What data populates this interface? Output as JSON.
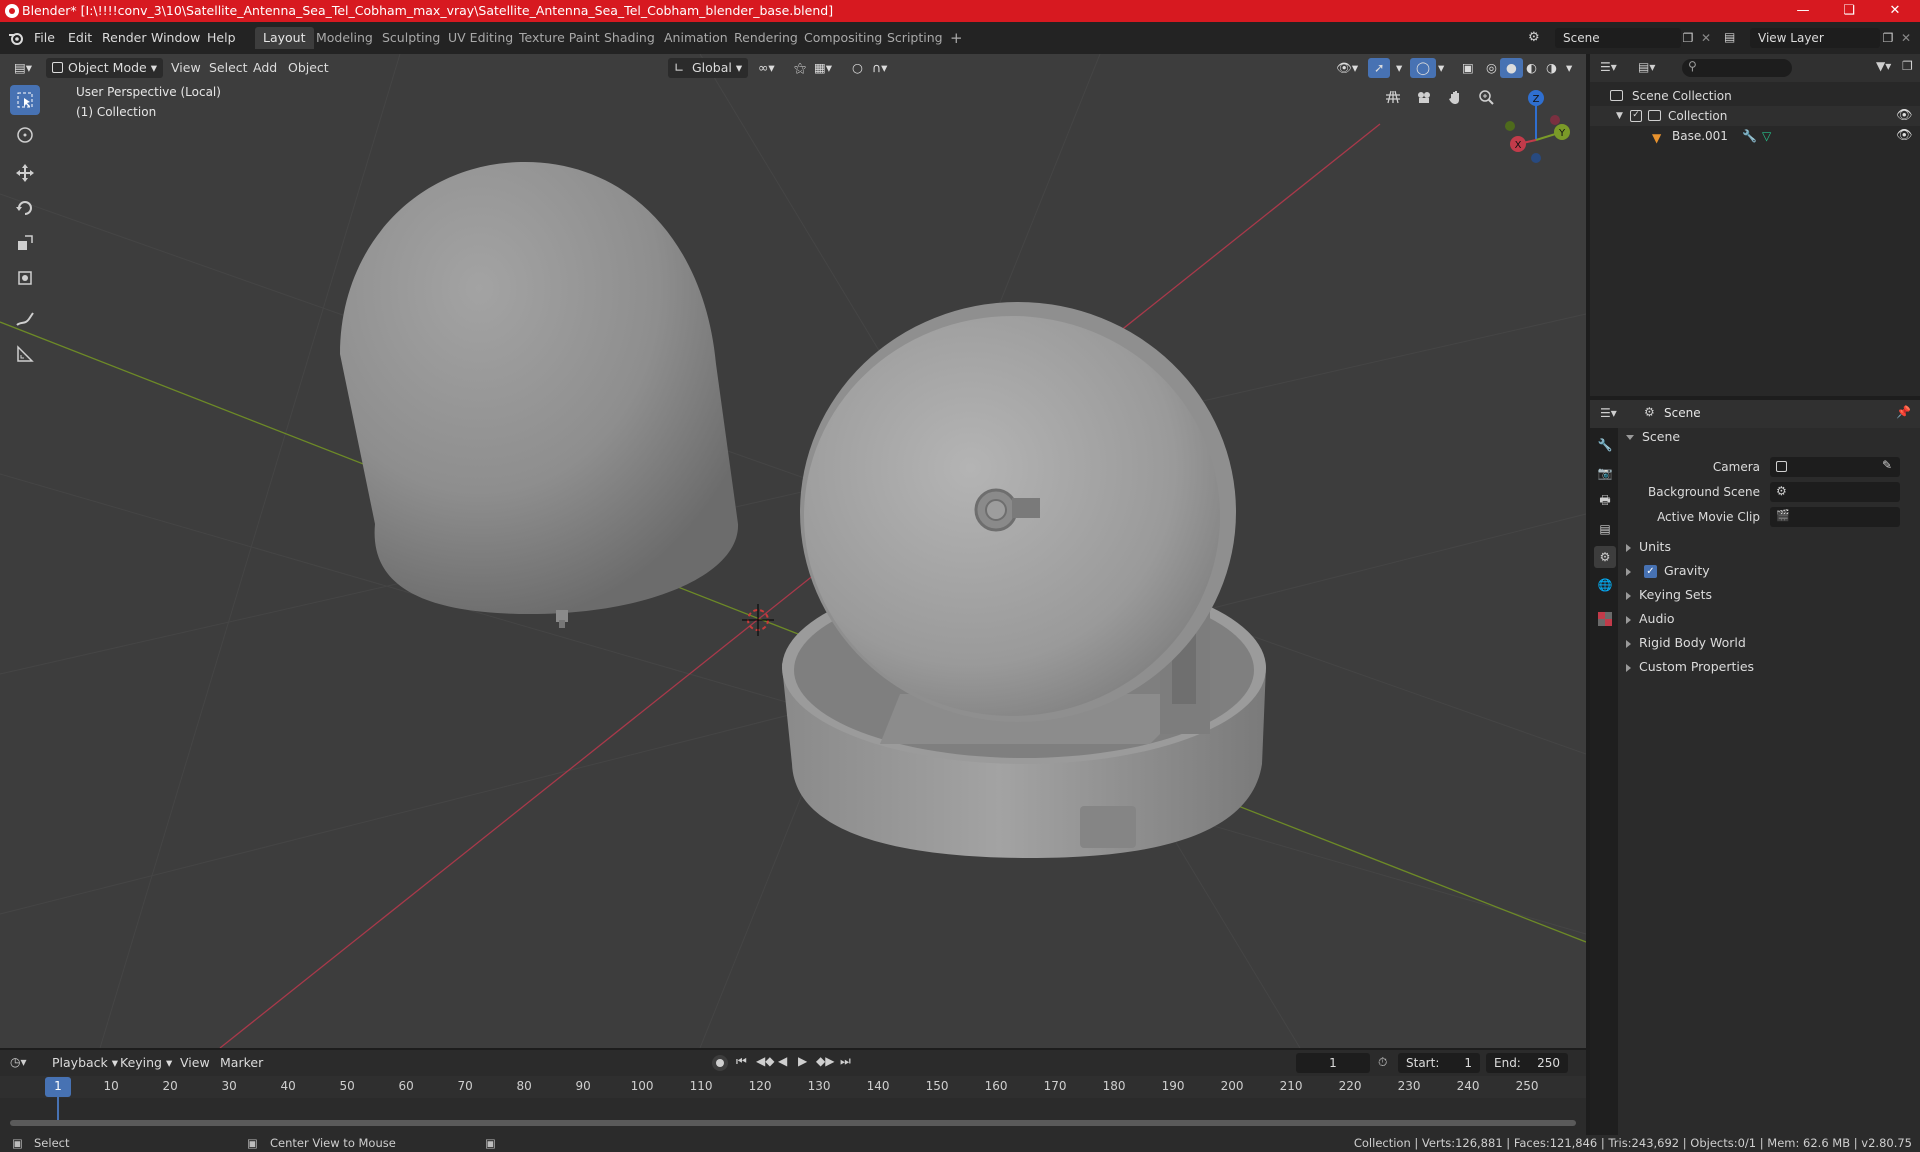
{
  "window": {
    "title": "Blender* [I:\\!!!!conv_3\\10\\Satellite_Antenna_Sea_Tel_Cobham_max_vray\\Satellite_Antenna_Sea_Tel_Cobham_blender_base.blend]",
    "controls": [
      "minimize-icon",
      "maximize-icon",
      "close-icon"
    ]
  },
  "menu": [
    "File",
    "Edit",
    "Render",
    "Window",
    "Help"
  ],
  "workspaces": {
    "active": "Layout",
    "tabs": [
      "Layout",
      "Modeling",
      "Sculpting",
      "UV Editing",
      "Texture Paint",
      "Shading",
      "Animation",
      "Rendering",
      "Compositing",
      "Scripting"
    ],
    "add": "+"
  },
  "scene_selector": {
    "value": "Scene"
  },
  "view_layer_selector": {
    "value": "View Layer"
  },
  "viewport": {
    "mode": "Object Mode",
    "menus": [
      "View",
      "Select",
      "Add",
      "Object"
    ],
    "transform_orientation": "Global",
    "perspective_label": "User Perspective (Local)",
    "collection_label": "(1) Collection",
    "gizmo_axes": {
      "x": "X",
      "y": "Y",
      "z": "Z"
    },
    "colors": {
      "background": "#3d3d3d",
      "x_axis": "#c23b4a",
      "y_axis": "#7a9a28",
      "z_axis": "#2f6fd0",
      "accent": "#4772b3"
    }
  },
  "toolbar": [
    "select-box-icon",
    "cursor-icon",
    "move-icon",
    "rotate-icon",
    "scale-icon",
    "transform-icon",
    "annotate-icon",
    "measure-icon"
  ],
  "outliner": {
    "root": "Scene Collection",
    "collection": "Collection",
    "object": "Base.001",
    "search_placeholder": ""
  },
  "properties": {
    "header": "Scene",
    "panel_title": "Scene",
    "fields": [
      {
        "label": "Camera",
        "value": ""
      },
      {
        "label": "Background Scene",
        "value": ""
      },
      {
        "label": "Active Movie Clip",
        "value": ""
      }
    ],
    "sections": [
      "Units",
      "Gravity",
      "Keying Sets",
      "Audio",
      "Rigid Body World",
      "Custom Properties"
    ],
    "gravity_enabled": true
  },
  "timeline": {
    "menus": [
      "Playback",
      "Keying",
      "View",
      "Marker"
    ],
    "current_frame": "1",
    "start_label": "Start:",
    "start": "1",
    "end_label": "End:",
    "end": "250",
    "ticks": [
      "1",
      "10",
      "20",
      "30",
      "40",
      "50",
      "60",
      "70",
      "80",
      "90",
      "100",
      "110",
      "120",
      "130",
      "140",
      "150",
      "160",
      "170",
      "180",
      "190",
      "200",
      "210",
      "220",
      "230",
      "240",
      "250"
    ]
  },
  "statusbar": {
    "left": "Select",
    "middle": "Center View to Mouse",
    "right": "Collection | Verts:126,881 | Faces:121,846 | Tris:243,692 | Objects:0/1 | Mem: 62.6 MB | v2.80.75"
  }
}
